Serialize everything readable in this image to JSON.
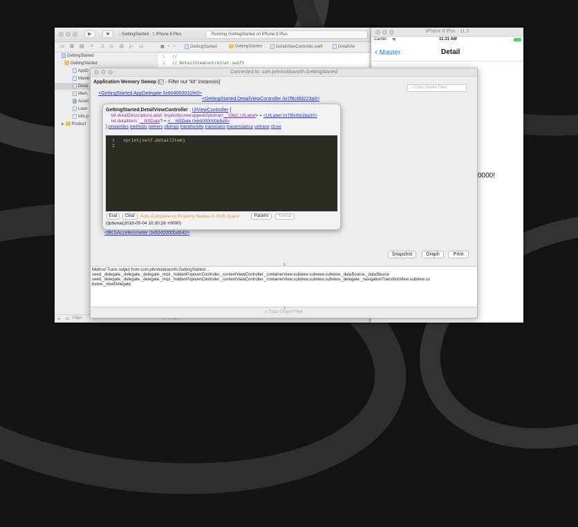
{
  "xcode": {
    "scheme": "GettingStarted",
    "device": "iPhone 8 Plus",
    "status": "Running GettingStarted on iPhone 8 Plus",
    "jump_bar": [
      "GettingStarted",
      "GettingStarted",
      "DetailViewController.swift",
      "DetailVie"
    ],
    "code_lines": [
      {
        "num": "1",
        "text": "//"
      },
      {
        "num": "2",
        "text": "//  DetailViewController.swift"
      }
    ],
    "navigator": [
      {
        "label": "GettingStarted",
        "kind": "project"
      },
      {
        "label": "GettingStarted",
        "kind": "folder"
      },
      {
        "label": "AppD",
        "kind": "file"
      },
      {
        "label": "Maste",
        "kind": "file"
      },
      {
        "label": "Detai",
        "kind": "file"
      },
      {
        "label": "Main.",
        "kind": "file"
      },
      {
        "label": "Asset",
        "kind": "file"
      },
      {
        "label": "Laun",
        "kind": "file"
      },
      {
        "label": "Info.p",
        "kind": "file"
      },
      {
        "label": "Product",
        "kind": "folder"
      }
    ],
    "filter_placeholder": "Filter",
    "debug_output_label": "All Output ◊"
  },
  "simulator": {
    "title": "iPhone 8 Plus - 11.3",
    "carrier": "Carrier",
    "time": "11:31 AM",
    "back_label": "Master",
    "nav_title": "Detail",
    "body_text": "0000!"
  },
  "tool": {
    "title": "Connected to: com.johnholdsworth.GettingStarted",
    "sweep_title": "Application Memory Sweep",
    "filter_label": "- Filter out \"kit\" instances)",
    "checkbox_symbol": "✓",
    "open_paren": "(",
    "class_filter_placeholder": "Class Name Filter",
    "links": {
      "app_delegate": "<GettingStarted.AppDelegate 0x604000031fe0>",
      "detail_vc": "<GettingStarted.DetailViewController 0x7f8c6fd223a0>",
      "accelerometer": "<BKSAccelerometer 0x6040000bd640>"
    },
    "popover": {
      "class_name": "GettingStarted.DetailViewController",
      "colon": ":",
      "superclass": "UIViewController",
      "brace_open": "{",
      "line1_prefix": "let detailDescriptionLabel: ImplicitlyUnwrappedOptional<",
      "line1_type": "__ObjC.UILabel",
      "line1_mid": "> =",
      "line1_value": "<UILabel 0x7f8c6fe2ba30>",
      "line2_prefix": "let detailItem:",
      "line2_type": "__NSDate",
      "line2_mid": "? =",
      "line2_value": "<__NSDate 0x60000000e5e0>",
      "brace_close": "}",
      "actions": [
        "properties",
        "methods",
        "owners",
        "siblings",
        "tracebundle",
        "traceclass",
        "traceinstance",
        "untrace",
        "close"
      ],
      "editor_lines": [
        {
          "num": "1",
          "text": "xprint(self.detailItem)"
        },
        {
          "num": "2",
          "text": ""
        }
      ],
      "eval_label": "Eval",
      "clear_label": "Clear",
      "autocomplete_hint": "Auto-Complete on Property Names is Shift-Space",
      "params_label": "Params",
      "source_label": "Source",
      "result": "Optional(2018-05-04 10:30:28 +0000)"
    },
    "snapshot_label": "Snapshot",
    "graph_label": "Graph",
    "print_label": "Print",
    "trace_lines": [
      "Method Trace output from com.johnholdsworth.GettingStarted ...",
      "seed._delegate._delegate._delegate._impl._hiddenPopoverController._contentViewController._containerView.subview.subview.subview._dataSource._dataSource",
      "seed._delegate._delegate._delegate._impl._hiddenPopoverController._contentViewController._containerView.subview.subview.subview._delegate._navigationTransitionView.subview.su",
      "bview._viewDelegate"
    ],
    "trace_filter_placeholder": "Trace Output Filter"
  },
  "colors": {
    "link": "#2233cc",
    "type_purple": "#8a2fb5",
    "keyword_green": "#2d7d2d",
    "hint_orange": "#e39a2a",
    "editor_bg": "#2b2c26",
    "ios_blue": "#157efb"
  }
}
